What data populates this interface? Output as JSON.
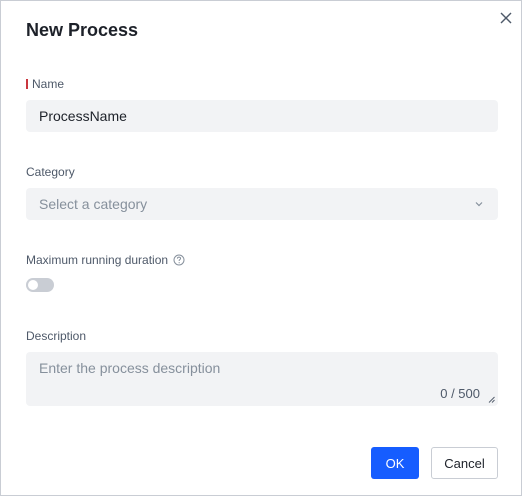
{
  "dialog": {
    "title": "New Process",
    "close_icon": "close-icon"
  },
  "fields": {
    "name": {
      "label": "Name",
      "required": true,
      "value": "ProcessName"
    },
    "category": {
      "label": "Category",
      "placeholder": "Select a category",
      "icon": "chevron-down-icon"
    },
    "max_duration": {
      "label": "Maximum running duration",
      "help_icon": "question-circle-icon",
      "enabled": false
    },
    "description": {
      "label": "Description",
      "placeholder": "Enter the process description",
      "counter": "0 / 500"
    }
  },
  "buttons": {
    "ok": "OK",
    "cancel": "Cancel"
  },
  "colors": {
    "primary": "#165dff",
    "required": "#c9363e",
    "field_bg": "#f2f3f5",
    "toggle_off": "#c9cdd4"
  }
}
